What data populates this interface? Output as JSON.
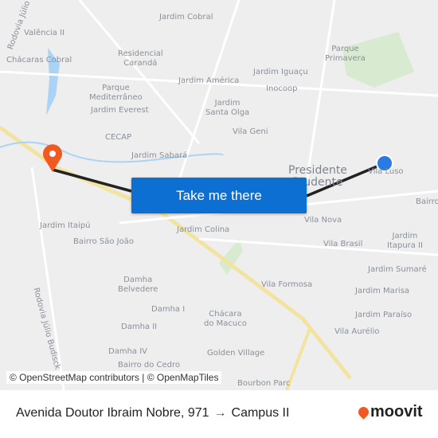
{
  "map": {
    "labels": [
      "Jardim Cobral",
      "Valência II",
      "Chácaras Cobral",
      "Residencial\nCarandá",
      "Parque\nPrimavera",
      "Jardim América",
      "Jardim Iguaçu",
      "Inocoop",
      "Parque\nMediterrâneo",
      "Jardim Everest",
      "Jardim\nSanta Olga",
      "Vila Geni",
      "CECAP",
      "Jardim Sabará",
      "Vila Luso",
      "Bairro",
      "Jardim Itaipú",
      "Bairro São João",
      "Jardim Colina",
      "Vila Nova",
      "Vila Brasil",
      "Jardim\nItapura II",
      "Jardim Sumaré",
      "Jardim Marisa",
      "Vila Formosa",
      "Damha\nBelvedere",
      "Damha I",
      "Damha II",
      "Chácara\ndo Macuco",
      "Jardim Paraíso",
      "Vila Aurélio",
      "Damha IV",
      "Golden Village",
      "Bairro do Cedro",
      "Bourbon Parc",
      "Rodovia Júlio Budisck",
      "Rodovia Júlio Budisk"
    ],
    "city": "Presidente\nPrudente",
    "origin_color": "#2a7ae2",
    "destination_color": "#f05a22",
    "route_color": "#222222"
  },
  "cta": {
    "label": "Take me there"
  },
  "attribution": "© OpenStreetMap contributors | © OpenMapTiles",
  "footer": {
    "origin": "Avenida Doutor Ibraim Nobre, 971",
    "arrow": "→",
    "destination": "Campus II",
    "brand": "moovit"
  }
}
